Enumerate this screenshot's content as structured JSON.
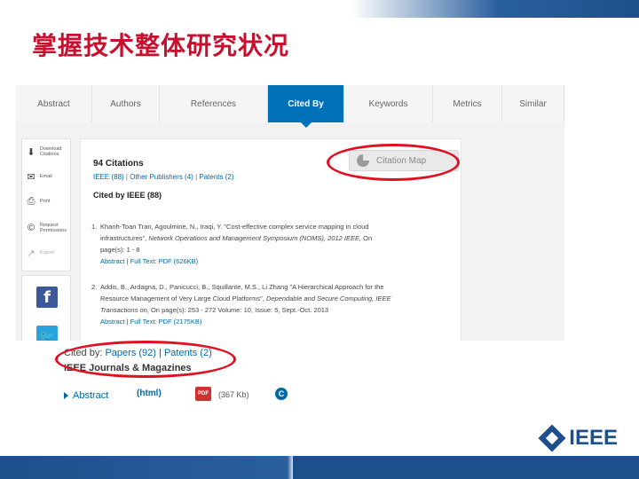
{
  "slide": {
    "title": "掌握技术整体研究状况",
    "brand_color": "#1d4f8c",
    "highlight_color": "#e01020"
  },
  "tabs": [
    {
      "label": "Abstract",
      "active": false
    },
    {
      "label": "Authors",
      "active": false
    },
    {
      "label": "References",
      "active": false
    },
    {
      "label": "Cited By",
      "active": true
    },
    {
      "label": "Keywords",
      "active": false
    },
    {
      "label": "Metrics",
      "active": false
    },
    {
      "label": "Similar",
      "active": false
    }
  ],
  "tools": [
    {
      "icon": "download-icon",
      "label": "Download Citations"
    },
    {
      "icon": "email-icon",
      "label": "Email"
    },
    {
      "icon": "print-icon",
      "label": "Print"
    },
    {
      "icon": "permissions-icon",
      "label": "Request Permissions"
    },
    {
      "icon": "export-icon",
      "label": "Export"
    }
  ],
  "citations": {
    "count_label": "94 Citations",
    "ieee_link": "IEEE (88)",
    "other_link": "Other Publishers (4)",
    "patents_link": "Patents (2)",
    "section_title": "Cited by IEEE (88)",
    "map_button": "Citation Map",
    "items": [
      {
        "num": "1.",
        "authors": "Khanh-Toan Tran, Agoulmine, N., Iraqi, Y. \"Cost-effective complex service mapping in cloud",
        "line2": "infrastructures\",",
        "venue": "Network Operations and Management Symposium (NOMS), 2012 IEEE,",
        "venue_tail": " On",
        "line3": "page(s): 1 - 8",
        "links": "Abstract | Full Text: PDF (626KB)"
      },
      {
        "num": "2.",
        "authors": "Addis, B., Ardagna, D., Panicucci, B., Squillante, M.S., Li Zhang \"A Hierarchical Approach for the",
        "line2": "Resource Management of Very Large Cloud Platforms\",",
        "venue": "Dependable and Secure Computing, IEEE",
        "line3a": "Transactions on,",
        "line3b": " On page(s): 253 - 272 Volume: 10, Issue: 5, Sept.-Oct. 2013",
        "links": "Abstract | Full Text: PDF (2175KB)"
      }
    ]
  },
  "lower": {
    "cited_by_prefix": "Cited by: ",
    "papers_link": "Papers (92)",
    "sep": " | ",
    "patents_link": "Patents (2)",
    "journals": "IEEE Journals & Magazines",
    "abstract_link": "Abstract",
    "html_label": "(html)",
    "pdf_label": "PDF",
    "pdf_size": "(367 Kb)",
    "copyright_glyph": "C"
  },
  "logo": {
    "text": "IEEE"
  }
}
